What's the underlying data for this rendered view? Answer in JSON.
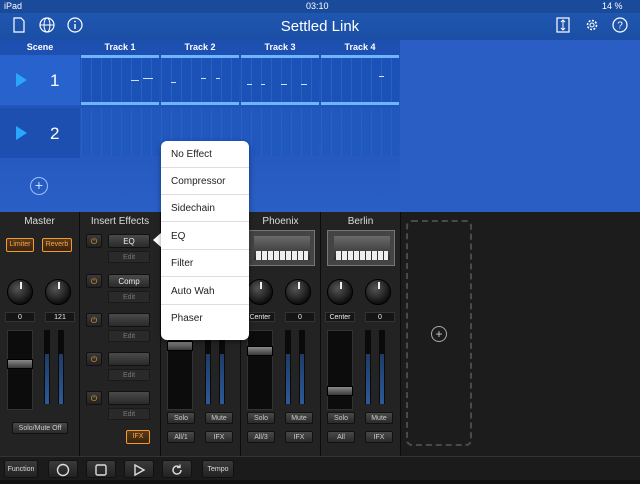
{
  "status_bar": {
    "device": "iPad",
    "time": "03:10",
    "battery": "14 %"
  },
  "nav": {
    "title": "Settled Link",
    "left_icons": [
      "document-icon",
      "globe-icon",
      "info-icon"
    ],
    "right_icons": [
      "resize-icon",
      "gear-icon",
      "help-icon"
    ]
  },
  "scene_header": "Scene",
  "tracks": [
    "Track 1",
    "Track 2",
    "Track 3",
    "Track 4"
  ],
  "scenes": [
    "1",
    "2"
  ],
  "mixer": {
    "master": {
      "title": "Master",
      "limiter": "Limiter",
      "reverb": "Reverb",
      "val_left": "0",
      "val_right": "121",
      "solo_mute_off": "Solo/Mute Off"
    },
    "insert_effects": {
      "title": "Insert Effects",
      "slots": [
        "EQ",
        "Comp",
        "",
        "",
        ""
      ],
      "edit": "Edit",
      "ifx": "IFX"
    },
    "channels": [
      {
        "title": "",
        "pan": "",
        "vol": "",
        "solo": "Solo",
        "mute": "Mute",
        "all": "All/1",
        "ifx": "IFX"
      },
      {
        "title": "Phoenix",
        "pan": "Center",
        "vol": "0",
        "solo": "Solo",
        "mute": "Mute",
        "all": "All/3",
        "ifx": "IFX"
      },
      {
        "title": "Berlin",
        "pan": "Center",
        "vol": "0",
        "solo": "Solo",
        "mute": "Mute",
        "all": "All",
        "ifx": "IFX"
      }
    ]
  },
  "transport": {
    "function": "Function",
    "tempo": "Tempo"
  },
  "effect_menu": {
    "items": [
      "No Effect",
      "Compressor",
      "Sidechain",
      "EQ",
      "Filter",
      "Auto Wah",
      "Phaser"
    ]
  }
}
